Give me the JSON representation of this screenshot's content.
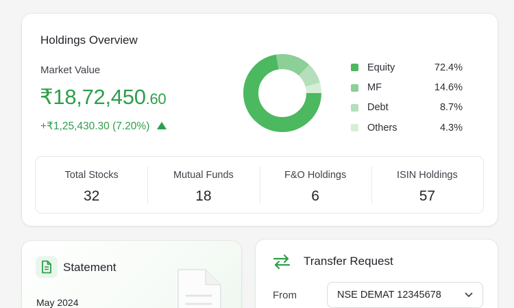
{
  "overview": {
    "title": "Holdings Overview",
    "market_value_label": "Market Value",
    "market_value_main": "₹18,72,450",
    "market_value_decimal": ".60",
    "change_text": "+₹1,25,430.30 (7.20%)",
    "change_direction": "up",
    "accent_color": "#2e9e4a",
    "allocation": [
      {
        "name": "Equity",
        "percent_label": "72.4%",
        "value": 72.4,
        "color": "#4cb85f"
      },
      {
        "name": "MF",
        "percent_label": "14.6%",
        "value": 14.6,
        "color": "#8ccf97"
      },
      {
        "name": "Debt",
        "percent_label": "8.7%",
        "value": 8.7,
        "color": "#b4dfba"
      },
      {
        "name": "Others",
        "percent_label": "4.3%",
        "value": 4.3,
        "color": "#d5eed8"
      }
    ],
    "stats": [
      {
        "label": "Total Stocks",
        "value": "32"
      },
      {
        "label": "Mutual Funds",
        "value": "18"
      },
      {
        "label": "F&O Holdings",
        "value": "6"
      },
      {
        "label": "ISIN Holdings",
        "value": "57"
      }
    ]
  },
  "statement": {
    "title": "Statement",
    "icon": "document-icon",
    "date": "May 2024"
  },
  "transfer": {
    "title": "Transfer Request",
    "icon": "swap-arrows-icon",
    "from_label": "From",
    "from_value": "NSE DEMAT 12345678"
  }
}
